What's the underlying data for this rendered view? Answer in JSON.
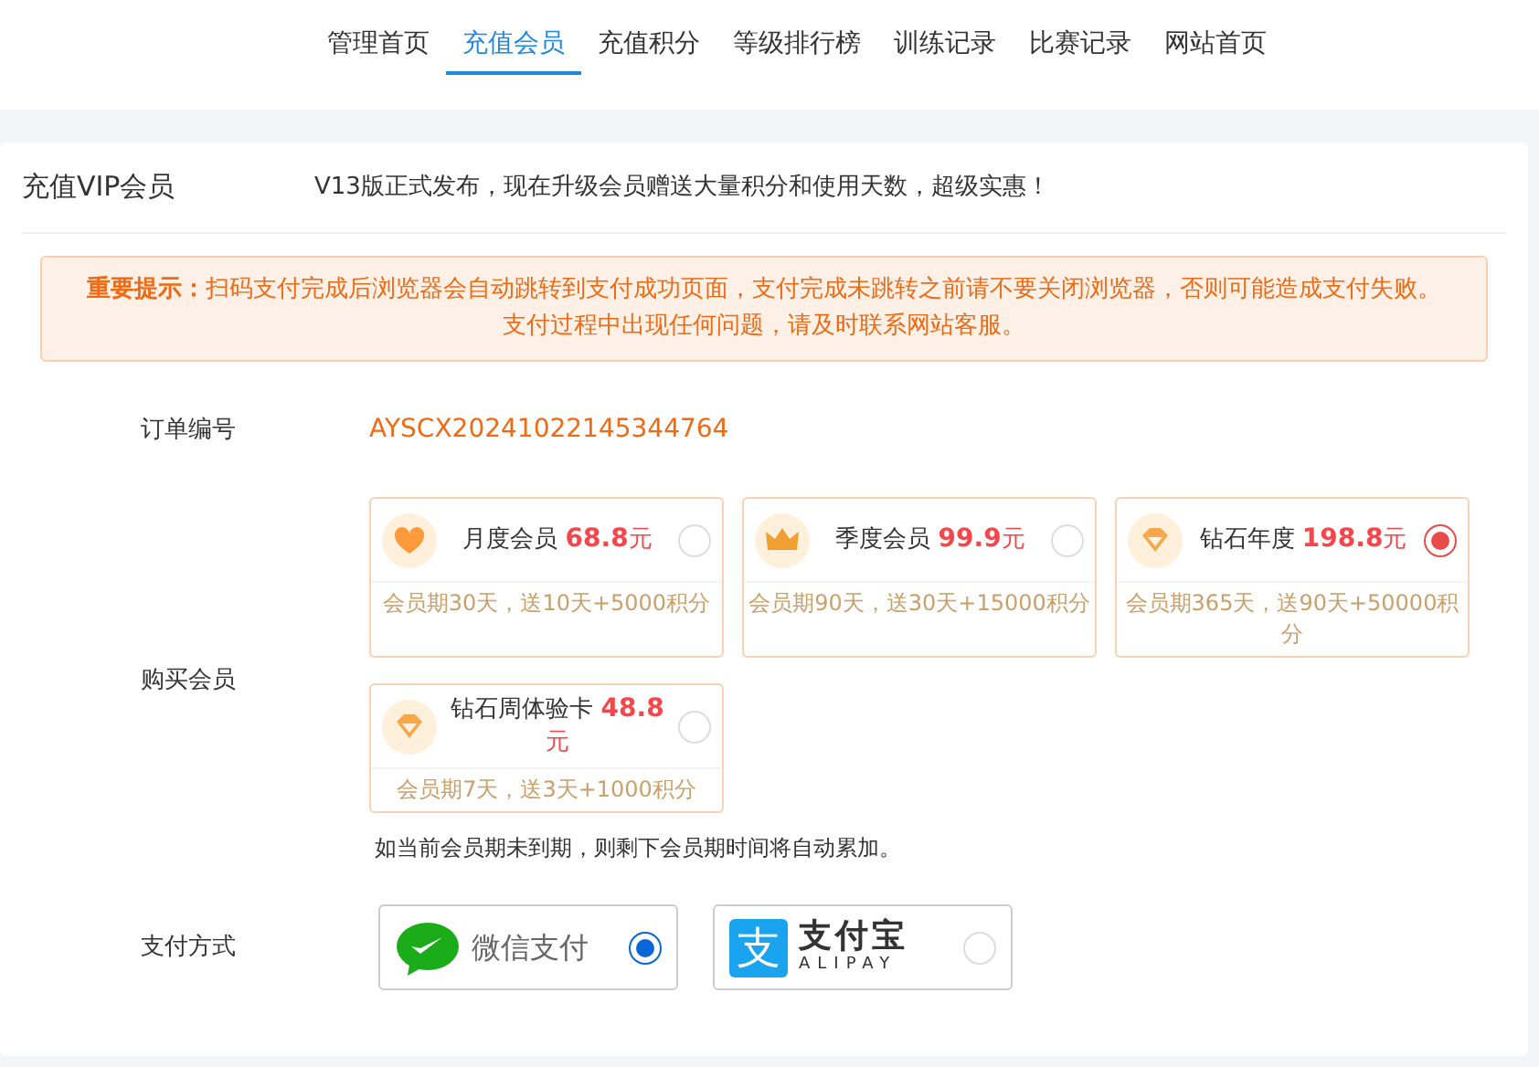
{
  "nav": [
    {
      "label": "管理首页",
      "selected": false
    },
    {
      "label": "充值会员",
      "selected": true
    },
    {
      "label": "充值积分",
      "selected": false
    },
    {
      "label": "等级排行榜",
      "selected": false
    },
    {
      "label": "训练记录",
      "selected": false
    },
    {
      "label": "比赛记录",
      "selected": false
    },
    {
      "label": "网站首页",
      "selected": false
    }
  ],
  "card": {
    "title": "充值VIP会员",
    "announcement": "V13版正式发布，现在升级会员赠送大量积分和使用天数，超级实惠！",
    "alert": {
      "lead": "重要提示：",
      "text": "扫码支付完成后浏览器会自动跳转到支付成功页面，支付完成未跳转之前请不要关闭浏览器，否则可能造成支付失败。",
      "line2": "支付过程中出现任何问题，请及时联系网站客服。"
    },
    "order": {
      "label": "订单编号",
      "value": "AYSCX20241022145344764"
    },
    "plans_label": "购买会员",
    "plans": [
      {
        "kind": "heart",
        "name": "月度会员",
        "price": "68.8",
        "unit": "元",
        "desc": "会员期30天，送10天+5000积分",
        "selected": false
      },
      {
        "kind": "crown",
        "name": "季度会员",
        "price": "99.9",
        "unit": "元",
        "desc": "会员期90天，送30天+15000积分",
        "selected": false
      },
      {
        "kind": "diamond",
        "name": "钻石年度",
        "price": "198.8",
        "unit": "元",
        "desc": "会员期365天，送90天+50000积分",
        "selected": true
      },
      {
        "kind": "diamond",
        "name": "钻石周体验卡",
        "price": "48.8",
        "unit": "元",
        "desc": "会员期7天，送3天+1000积分",
        "selected": false
      }
    ],
    "plans_note": "如当前会员期未到期，则剩下会员期时间将自动累加。",
    "pay_label": "支付方式",
    "payments": [
      {
        "kind": "wechat",
        "name": "微信支付",
        "selected": true
      },
      {
        "kind": "alipay",
        "mark": "支",
        "name": "支付宝",
        "sub": "ALIPAY",
        "selected": false
      }
    ]
  }
}
